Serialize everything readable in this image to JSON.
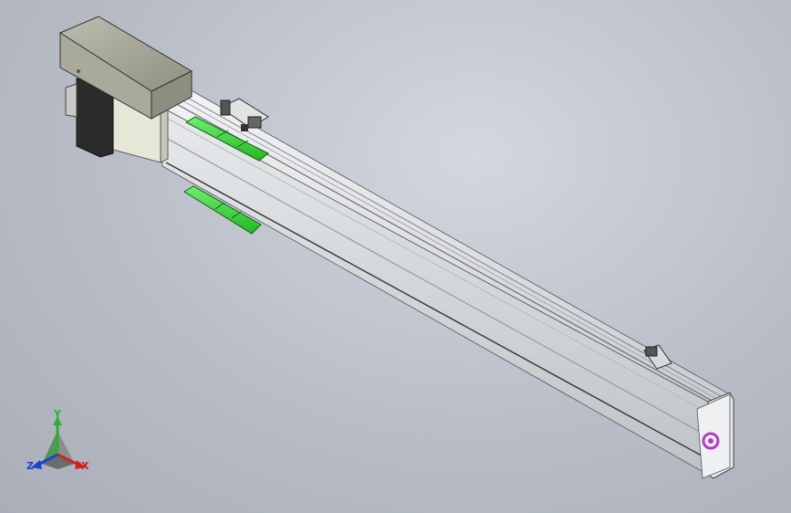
{
  "viewport": {
    "background": "#b8bdc7"
  },
  "model": {
    "body_color": "#d9dcdf",
    "motor_color": "#a9aa9c",
    "bracket_color": "#2fd12f",
    "logo_color": "#b43ac4"
  },
  "triad": {
    "x_label": "X",
    "y_label": "Y",
    "z_label": "Z",
    "x_color": "#d02020",
    "y_color": "#2cb02c",
    "z_color": "#2040d0"
  }
}
